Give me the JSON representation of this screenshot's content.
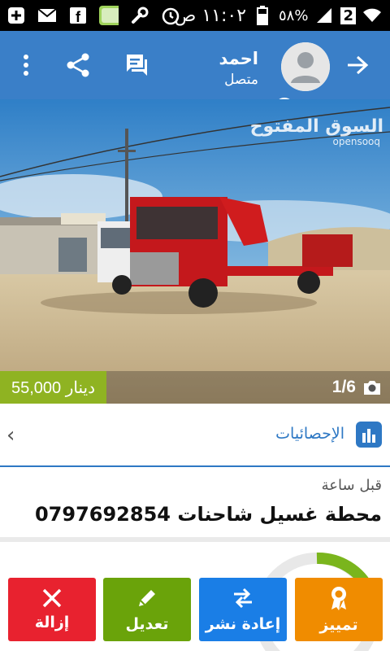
{
  "status_bar": {
    "time": "١١:٠٢ ص",
    "battery": "٥٨%",
    "notification_count": "2",
    "colors": {
      "background": "#000000",
      "text": "#ffffff"
    }
  },
  "app_bar": {
    "user_name": "احمد",
    "user_status": "متصل",
    "colors": {
      "background": "#3a7fc8",
      "online": "#7ab51d"
    },
    "icons": [
      "back-arrow-icon",
      "avatar-icon",
      "chat-icon",
      "share-icon",
      "more-vert-icon"
    ]
  },
  "photo": {
    "price": "55,000 دينار",
    "counter": "1/6",
    "watermark_ar": "السوق المفتوح",
    "watermark_en": "opensooq"
  },
  "stats": {
    "label": "الإحصائيات",
    "accent": "#2e78c4"
  },
  "ad": {
    "posted": "قبل ساعة",
    "title": "محطة غسيل شاحنات 0797692854"
  },
  "actions": [
    {
      "label": "تمييز",
      "color": "#f08c00",
      "icon": "award-icon"
    },
    {
      "label": "إعادة نشر",
      "color": "#1a7ee6",
      "icon": "repost-icon"
    },
    {
      "label": "تعديل",
      "color": "#6aa30a",
      "icon": "edit-icon"
    },
    {
      "label": "إزالة",
      "color": "#e8222f",
      "icon": "close-icon"
    }
  ]
}
